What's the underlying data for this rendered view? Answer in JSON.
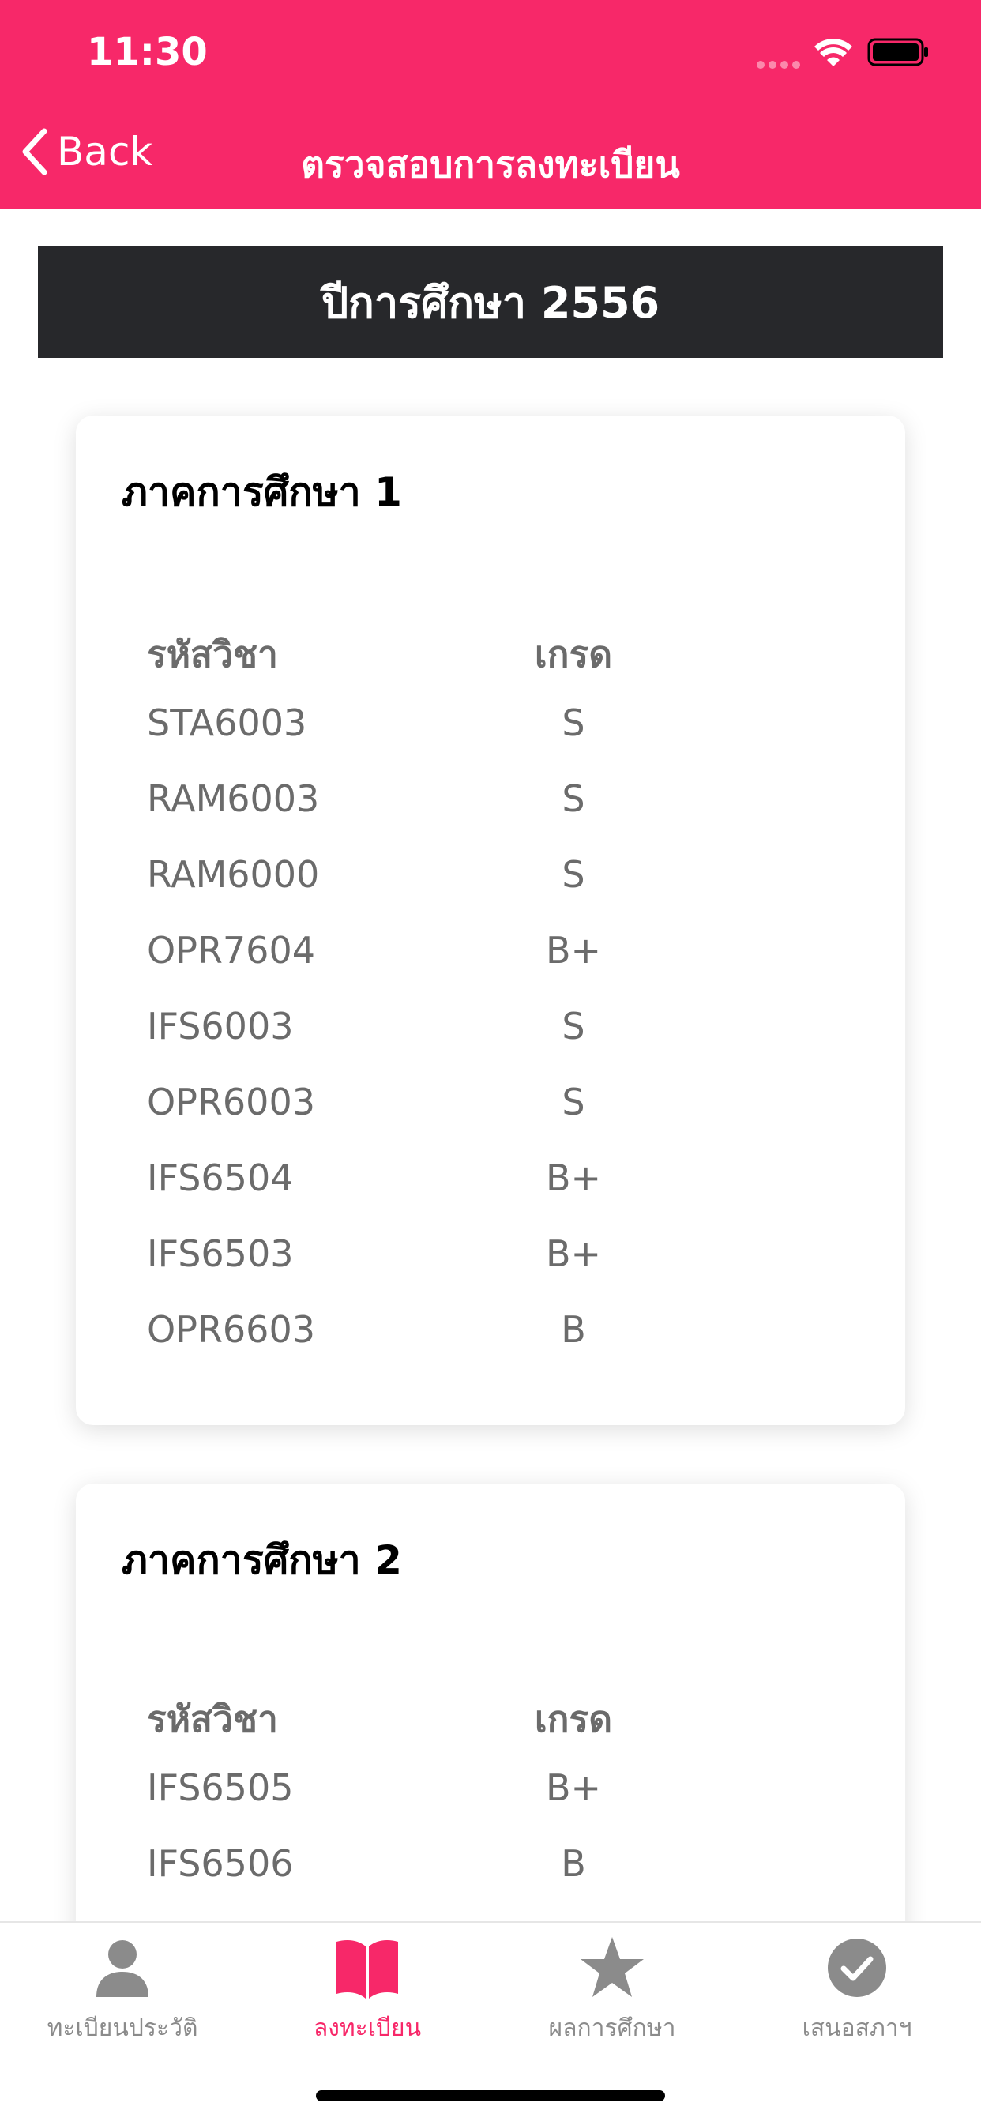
{
  "status_bar": {
    "time": "11:30"
  },
  "nav": {
    "back_label": "Back",
    "title": "ตรวจสอบการลงทะเบียน"
  },
  "year_label": "ปีการศึกษา 2556",
  "colors": {
    "primary": "#f72869",
    "year_bar": "#27282b",
    "inactive_tab": "#8b8b8b"
  },
  "semesters": [
    {
      "title": "ภาคการศึกษา 1",
      "col_code": "รหัสวิชา",
      "col_grade": "เกรด",
      "rows": [
        {
          "code": "STA6003",
          "grade": "S"
        },
        {
          "code": "RAM6003",
          "grade": "S"
        },
        {
          "code": "RAM6000",
          "grade": "S"
        },
        {
          "code": "OPR7604",
          "grade": "B+"
        },
        {
          "code": "IFS6003",
          "grade": "S"
        },
        {
          "code": "OPR6003",
          "grade": "S"
        },
        {
          "code": "IFS6504",
          "grade": "B+"
        },
        {
          "code": "IFS6503",
          "grade": "B+"
        },
        {
          "code": "OPR6603",
          "grade": "B"
        }
      ]
    },
    {
      "title": "ภาคการศึกษา 2",
      "col_code": "รหัสวิชา",
      "col_grade": "เกรด",
      "rows": [
        {
          "code": "IFS6505",
          "grade": "B+"
        },
        {
          "code": "IFS6506",
          "grade": "B"
        }
      ]
    }
  ],
  "tabs": [
    {
      "label": "ทะเบียนประวัติ",
      "icon": "person-icon",
      "active": false
    },
    {
      "label": "ลงทะเบียน",
      "icon": "book-icon",
      "active": true
    },
    {
      "label": "ผลการศึกษา",
      "icon": "star-icon",
      "active": false
    },
    {
      "label": "เสนอสภาฯ",
      "icon": "check-circle-icon",
      "active": false
    }
  ]
}
